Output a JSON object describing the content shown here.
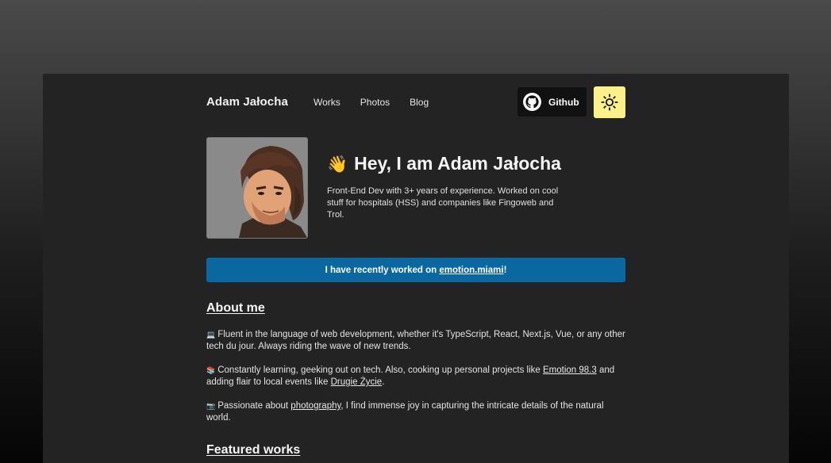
{
  "header": {
    "brand": "Adam Jałocha",
    "nav": [
      "Works",
      "Photos",
      "Blog"
    ],
    "github_label": "Github",
    "theme_icon": "sun-icon"
  },
  "hero": {
    "wave_emoji": "👋",
    "title": "Hey, I am Adam Jałocha",
    "description": "Front-End Dev with 3+ years of experience. Worked on cool stuff for hospitals (HSS) and companies like Fingoweb and Trol."
  },
  "banner": {
    "prefix": "I have recently worked on ",
    "link": "emotion.miami",
    "suffix": "!"
  },
  "about": {
    "heading": "About me",
    "p1": {
      "emoji": "💻",
      "text": "Fluent in the language of web development, whether it's TypeScript, React, Next.js, Vue, or any other tech du jour. Always riding the wave of new trends."
    },
    "p2": {
      "emoji": "📚",
      "before": "Constantly learning, geeking out on tech. Also, cooking up personal projects like ",
      "link1": "Emotion 98.3",
      "middle": " and adding flair to local events like ",
      "link2": "Drugie Życie",
      "after": "."
    },
    "p3": {
      "emoji": "📷",
      "before": "Passionate about ",
      "link": "photography",
      "after": ", I find immense joy in capturing the intricate details of the natural world."
    }
  },
  "featured": {
    "heading": "Featured works"
  },
  "colors": {
    "banner": "#0b679f",
    "theme_button": "#fbf08a",
    "window_bg": "#232323"
  }
}
